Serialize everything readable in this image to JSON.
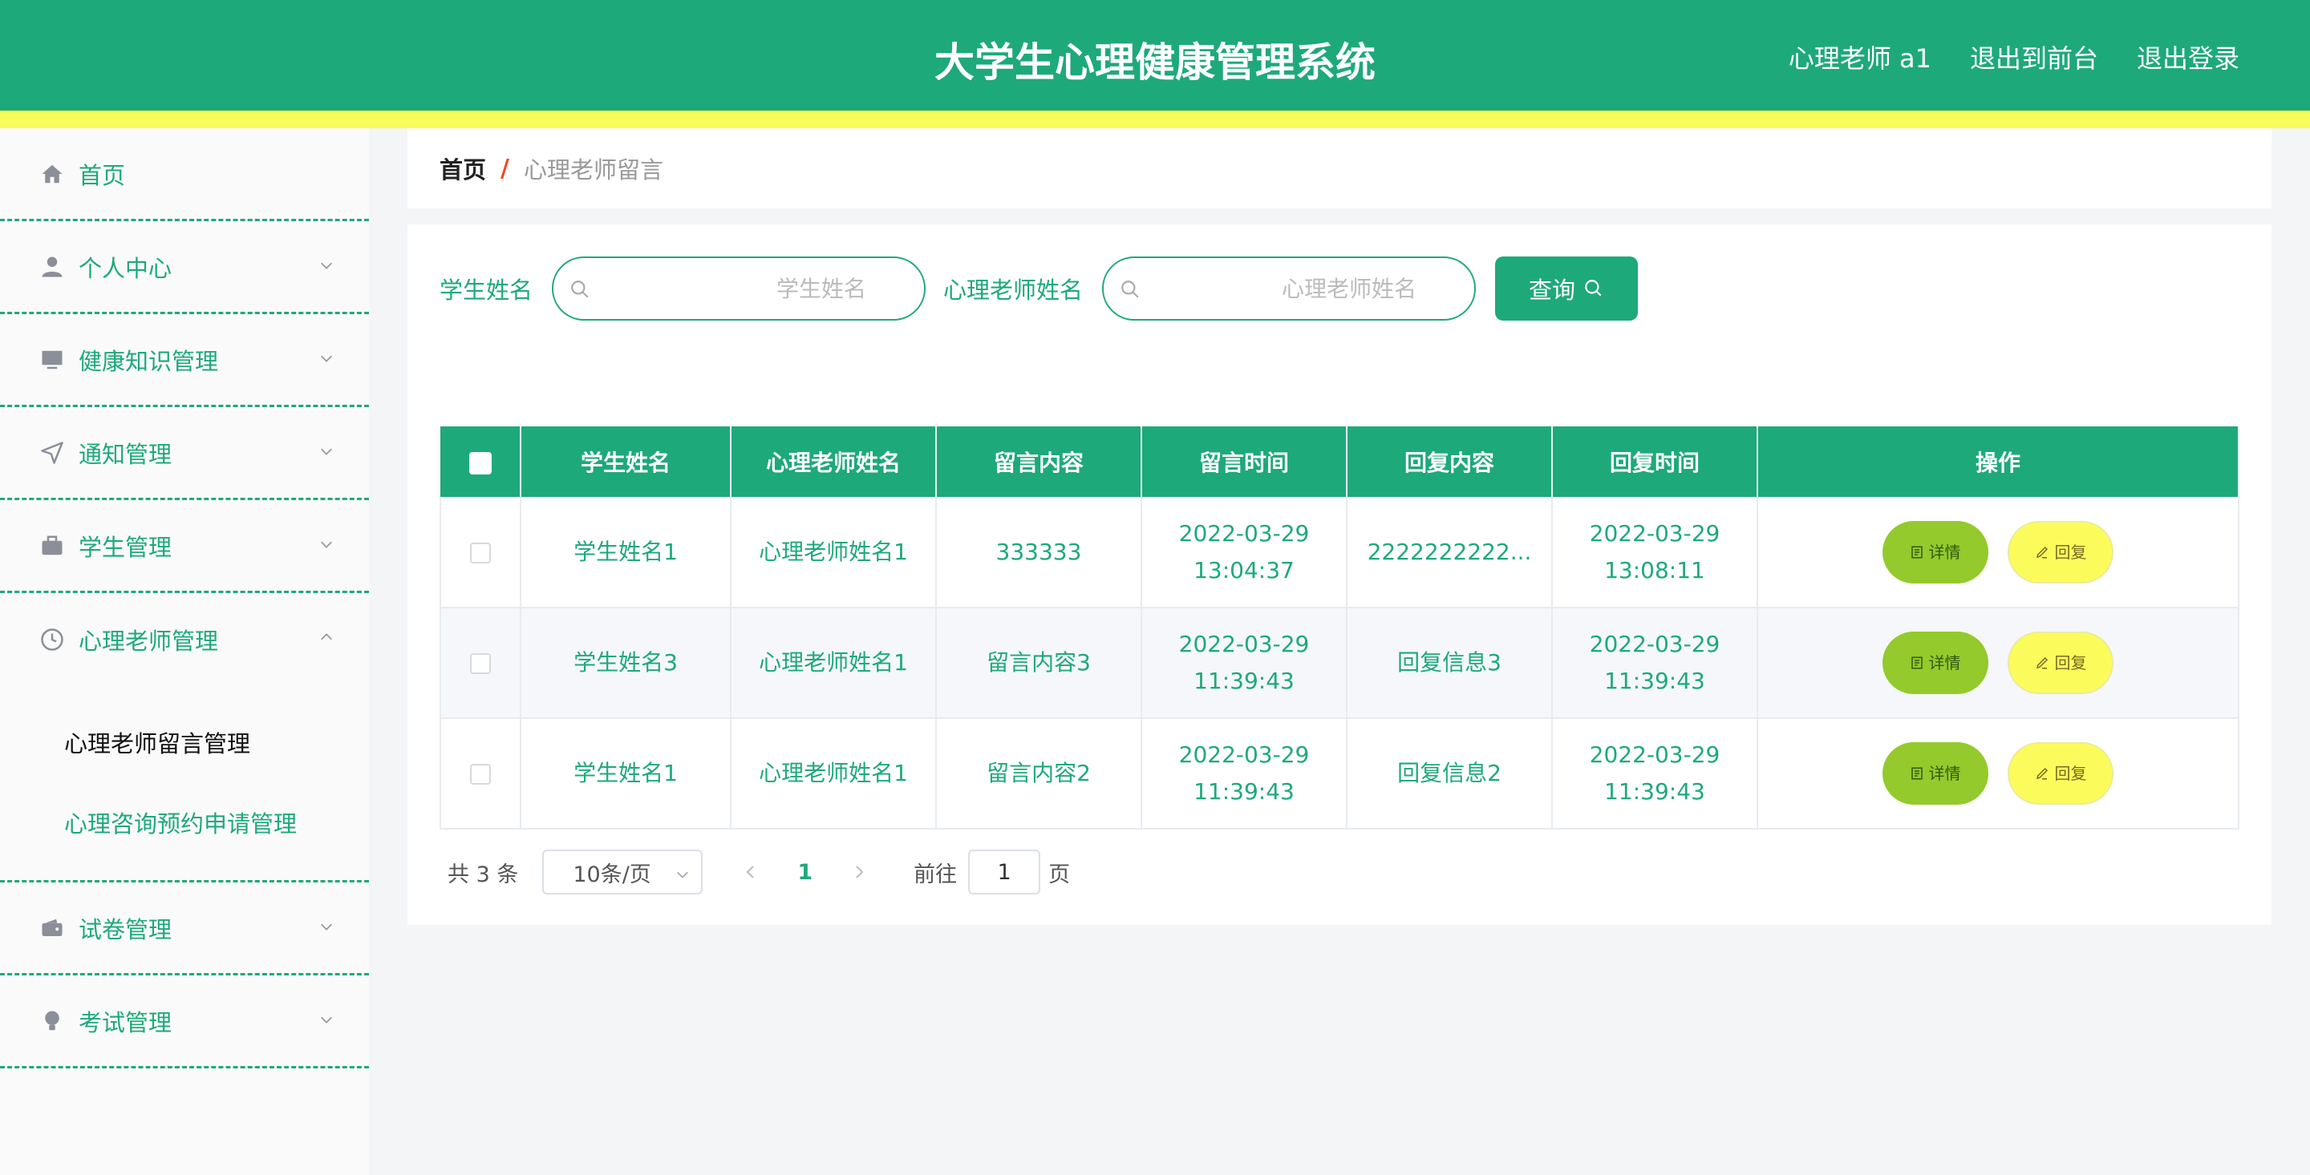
{
  "header": {
    "title": "大学生心理健康管理系统",
    "user": "心理老师 a1",
    "to_front": "退出到前台",
    "logout": "退出登录"
  },
  "sidebar": {
    "items": [
      {
        "label": "首页",
        "icon": "home-icon"
      },
      {
        "label": "个人中心",
        "icon": "user-icon"
      },
      {
        "label": "健康知识管理",
        "icon": "monitor-icon"
      },
      {
        "label": "通知管理",
        "icon": "send-icon"
      },
      {
        "label": "学生管理",
        "icon": "briefcase-icon"
      },
      {
        "label": "心理老师管理",
        "icon": "clock-icon"
      },
      {
        "label": "试卷管理",
        "icon": "wallet-icon"
      },
      {
        "label": "考试管理",
        "icon": "bulb-icon"
      }
    ],
    "submenu": [
      "心理老师留言管理",
      "心理咨询预约申请管理"
    ]
  },
  "breadcrumb": {
    "home": "首页",
    "separator": "/",
    "current": "心理老师留言"
  },
  "search": {
    "student_label": "学生姓名",
    "student_placeholder": "学生姓名",
    "teacher_label": "心理老师姓名",
    "teacher_placeholder": "心理老师姓名",
    "query_button": "查询"
  },
  "table": {
    "columns": [
      "学生姓名",
      "心理老师姓名",
      "留言内容",
      "留言时间",
      "回复内容",
      "回复时间",
      "操作"
    ],
    "rows": [
      {
        "student": "学生姓名1",
        "teacher": "心理老师姓名1",
        "content": "333333",
        "time": "2022-03-29 13:04:37",
        "reply": "2222222222...",
        "reply_time": "2022-03-29 13:08:11"
      },
      {
        "student": "学生姓名3",
        "teacher": "心理老师姓名1",
        "content": "留言内容3",
        "time": "2022-03-29 11:39:43",
        "reply": "回复信息3",
        "reply_time": "2022-03-29 11:39:43"
      },
      {
        "student": "学生姓名1",
        "teacher": "心理老师姓名1",
        "content": "留言内容2",
        "time": "2022-03-29 11:39:43",
        "reply": "回复信息2",
        "reply_time": "2022-03-29 11:39:43"
      }
    ],
    "detail_label": "详情",
    "reply_label": "回复"
  },
  "pagination": {
    "total": "共 3 条",
    "page_size": "10条/页",
    "current_page": "1",
    "goto_label": "前往",
    "goto_value": "1",
    "page_suffix": "页"
  },
  "colors": {
    "primary": "#1ea97a",
    "accent_stripe": "#f8fb5a",
    "detail_button": "#94ca2c",
    "reply_button": "#fbfc5c"
  }
}
